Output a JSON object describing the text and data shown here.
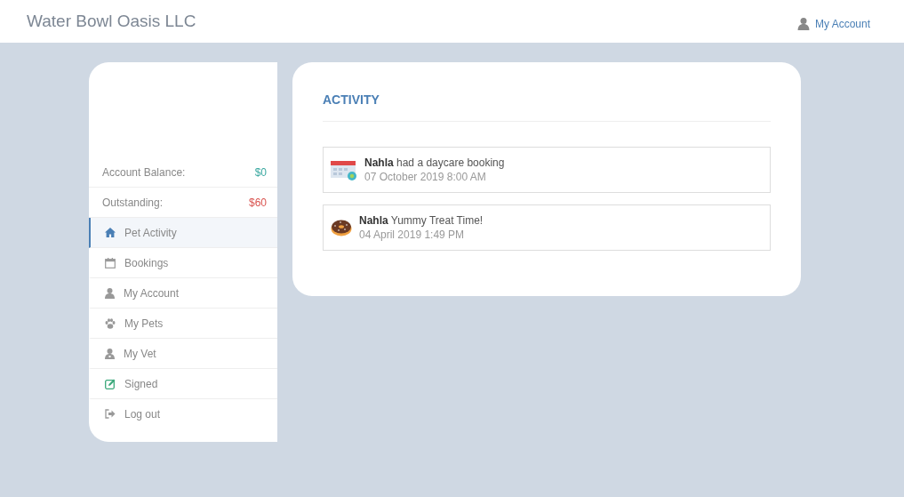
{
  "header": {
    "brand": "Water Bowl Oasis LLC",
    "account_link": "My Account"
  },
  "sidebar": {
    "balances": [
      {
        "label": "Account Balance:",
        "amount": "$0",
        "color": "#3aa8a0"
      },
      {
        "label": "Outstanding:",
        "amount": "$60",
        "color": "#d9534f"
      }
    ],
    "items": [
      {
        "label": "Pet Activity",
        "kind": "home",
        "selected": true
      },
      {
        "label": "Bookings",
        "kind": "calendar",
        "selected": false
      },
      {
        "label": "My Account",
        "kind": "user",
        "selected": false
      },
      {
        "label": "My Pets",
        "kind": "paw",
        "selected": false
      },
      {
        "label": "My Vet",
        "kind": "doctor",
        "selected": false
      },
      {
        "label": "Signed",
        "kind": "edit",
        "selected": false
      },
      {
        "label": "Log out",
        "kind": "logout",
        "selected": false
      }
    ]
  },
  "activity": {
    "title": "ACTIVITY",
    "items": [
      {
        "kind": "booking",
        "text": "**Nahla** had a daycare booking",
        "time": "07 October 2019 8:00 AM"
      },
      {
        "kind": "treat",
        "text": "**Nahla** Yummy Treat Time!",
        "time": "04 April 2019 1:49 PM"
      }
    ]
  }
}
